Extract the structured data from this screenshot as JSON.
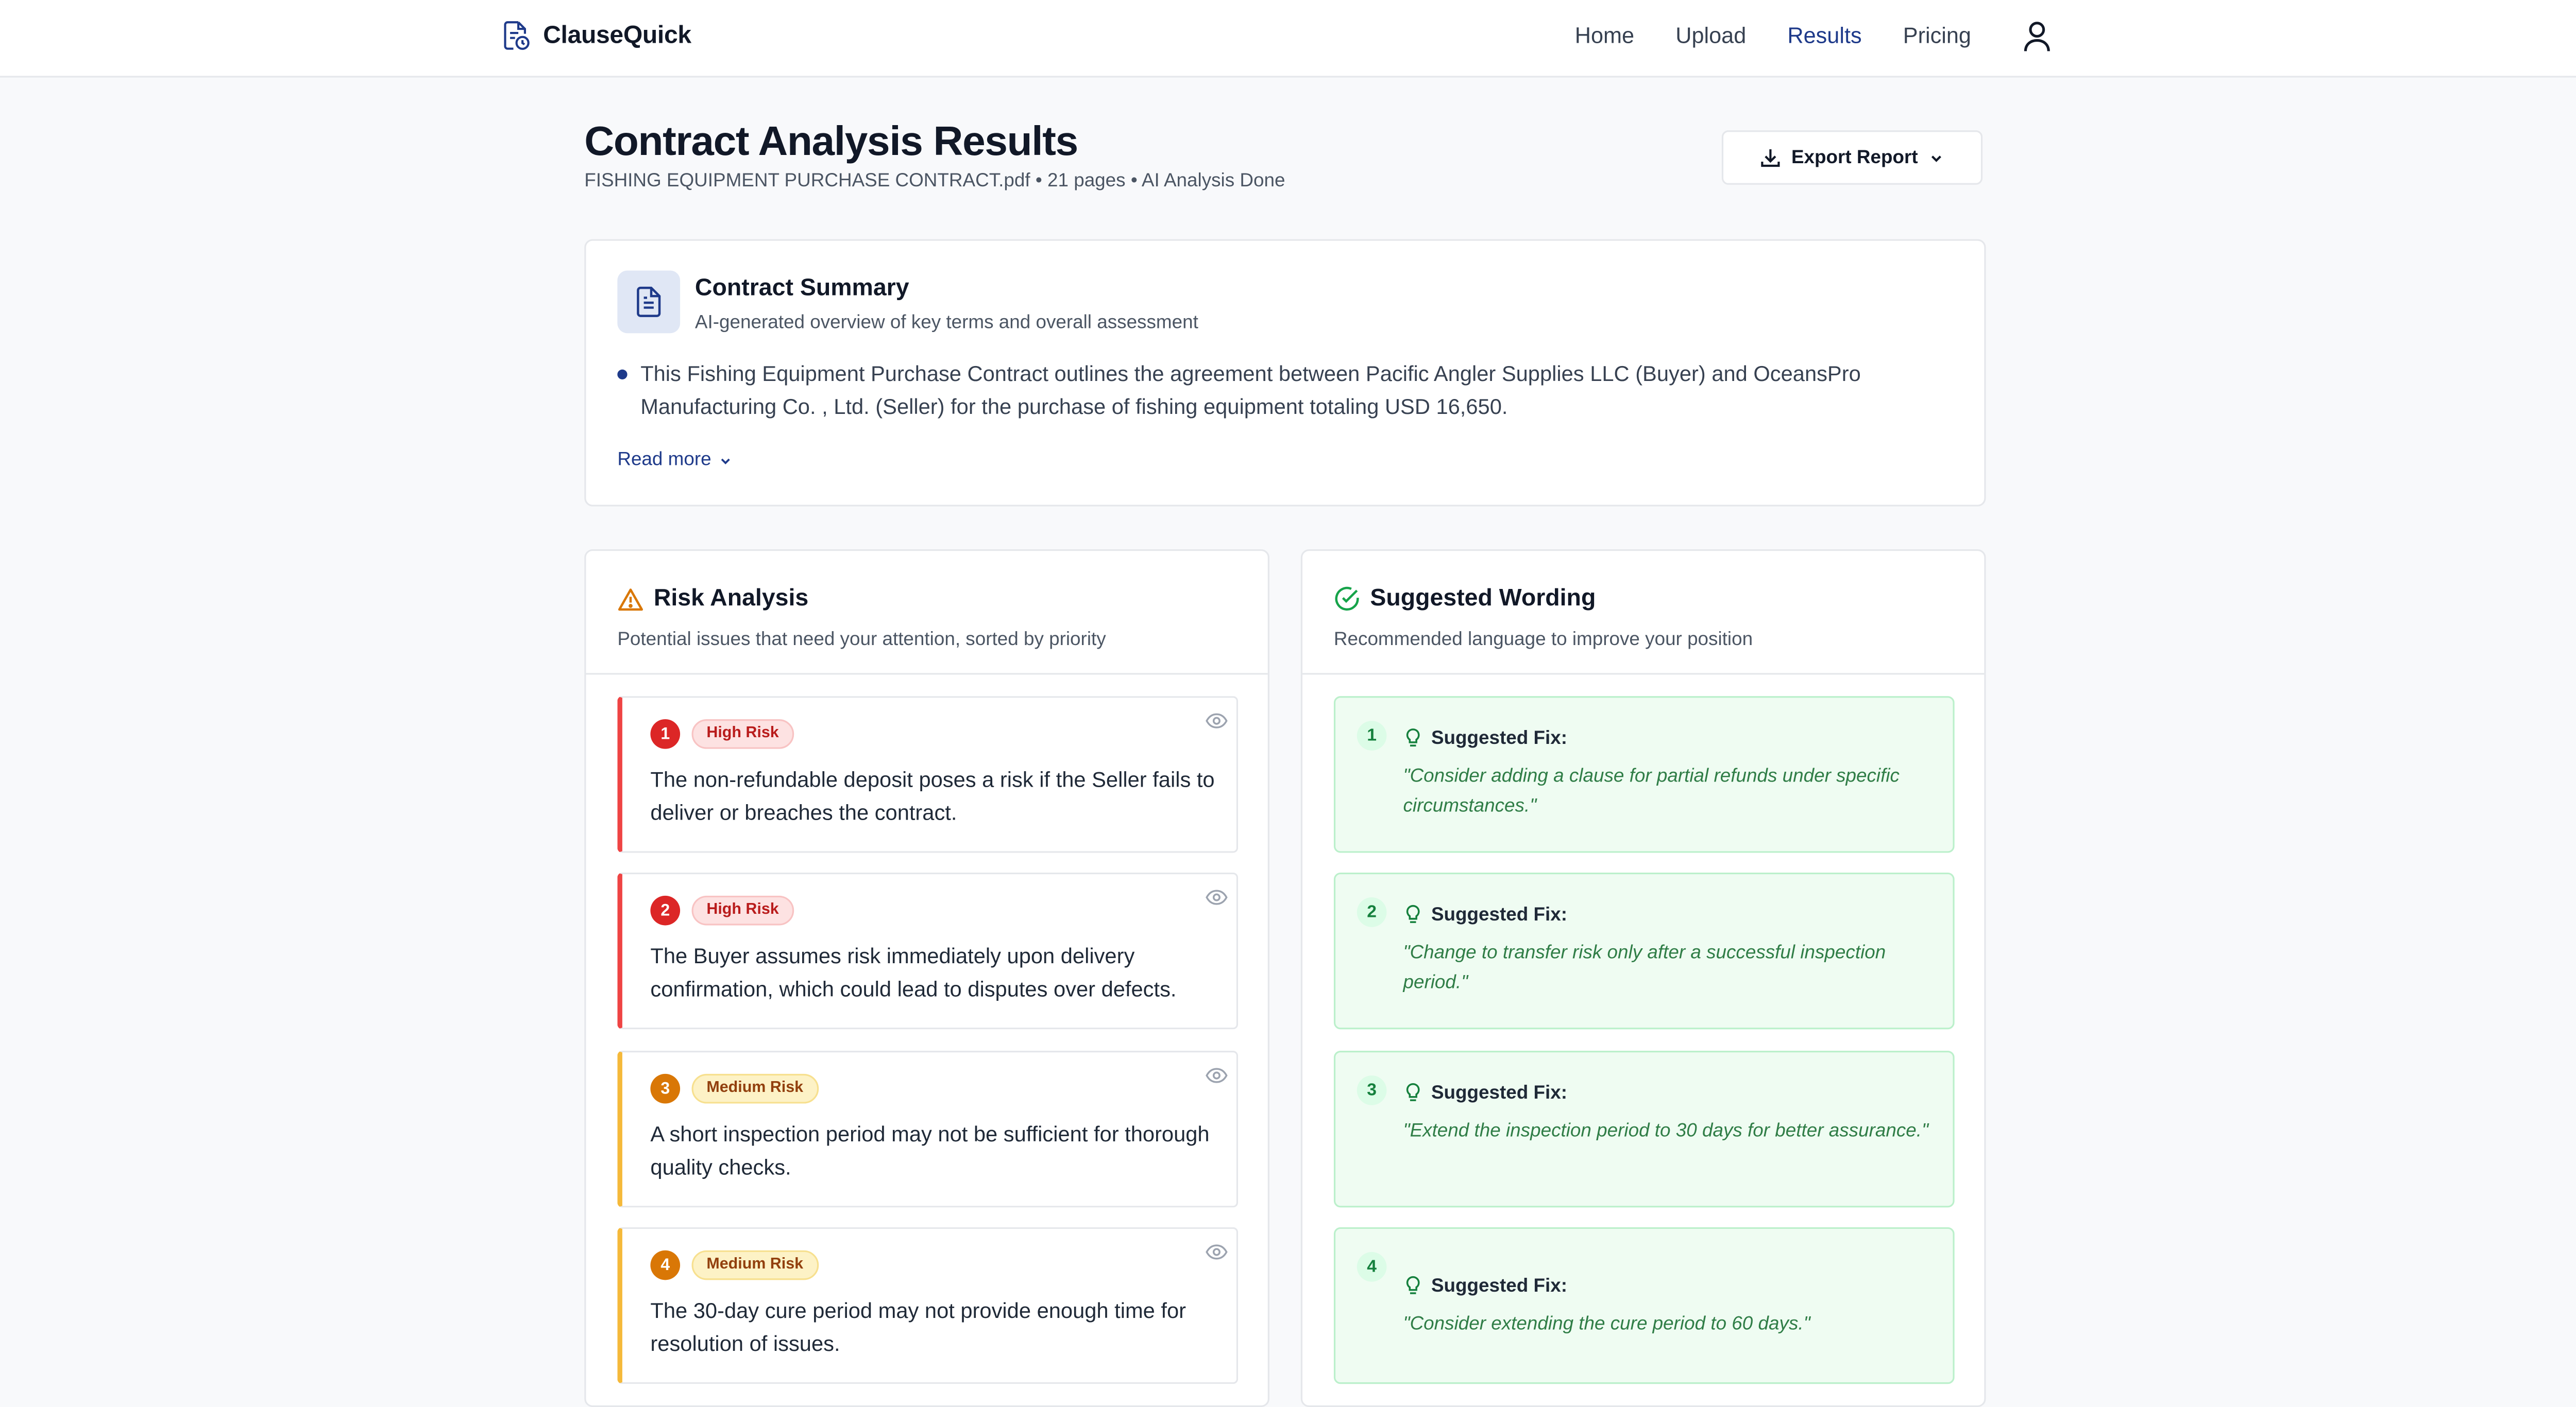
{
  "brand": {
    "name": "ClauseQuick"
  },
  "nav": {
    "home": "Home",
    "upload": "Upload",
    "results": "Results",
    "pricing": "Pricing"
  },
  "page": {
    "title": "Contract Analysis Results",
    "meta": "FISHING EQUIPMENT PURCHASE CONTRACT.pdf • 21 pages • AI Analysis Done",
    "export_label": "Export Report"
  },
  "summary": {
    "title": "Contract Summary",
    "subtitle": "AI-generated overview of key terms and overall assessment",
    "text": "This Fishing Equipment Purchase Contract outlines the agreement between Pacific Angler Supplies LLC (Buyer) and OceansPro Manufacturing Co. , Ltd. (Seller) for the purchase of fishing equipment totaling USD 16,650.",
    "read_more": "Read more"
  },
  "risk": {
    "title": "Risk Analysis",
    "subtitle": "Potential issues that need your attention, sorted by priority",
    "items": [
      {
        "num": "1",
        "badge": "High Risk",
        "text": "The non-refundable deposit poses a risk if the Seller fails to deliver or breaches the contract."
      },
      {
        "num": "2",
        "badge": "High Risk",
        "text": "The Buyer assumes risk immediately upon delivery confirmation, which could lead to disputes over defects."
      },
      {
        "num": "3",
        "badge": "Medium Risk",
        "text": "A short inspection period may not be sufficient for thorough quality checks."
      },
      {
        "num": "4",
        "badge": "Medium Risk",
        "text": "The 30-day cure period may not provide enough time for resolution of issues."
      }
    ]
  },
  "wording": {
    "title": "Suggested Wording",
    "subtitle": "Recommended language to improve your position",
    "fix_label": "Suggested Fix:",
    "items": [
      {
        "num": "1",
        "text": "\"Consider adding a clause for partial refunds under specific circumstances.\""
      },
      {
        "num": "2",
        "text": "\"Change to transfer risk only after a successful inspection period.\""
      },
      {
        "num": "3",
        "text": "\"Extend the inspection period to 30 days for better assurance.\""
      },
      {
        "num": "4",
        "text": "\"Consider extending the cure period to 60 days.\""
      }
    ]
  },
  "colors": {
    "accent": "#1e3a8a",
    "high_risk": "#dc2626",
    "medium_risk": "#d97706",
    "success": "#15803d"
  }
}
